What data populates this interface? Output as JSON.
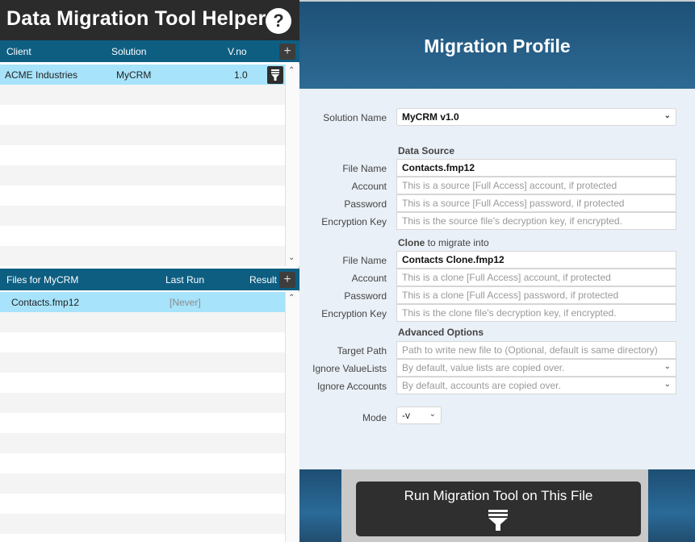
{
  "app": {
    "title": "Data Migration Tool Helper",
    "help_label": "?"
  },
  "clients_list": {
    "headers": {
      "client": "Client",
      "solution": "Solution",
      "version": "V.no"
    },
    "add_label": "+",
    "rows": [
      {
        "client": "ACME Industries",
        "solution": "MyCRM",
        "version": "1.0"
      }
    ]
  },
  "files_list": {
    "headers": {
      "files": "Files for MyCRM",
      "last_run": "Last Run",
      "result": "Result"
    },
    "add_label": "+",
    "rows": [
      {
        "file": "Contacts.fmp12",
        "last_run": "[Never]"
      }
    ]
  },
  "profile": {
    "title": "Migration Profile",
    "solution_name": {
      "label": "Solution Name",
      "value": "MyCRM v1.0"
    },
    "data_source": {
      "heading": "Data Source",
      "file_name": {
        "label": "File Name",
        "value": "Contacts.fmp12"
      },
      "account": {
        "label": "Account",
        "placeholder": "This is a source [Full Access] account, if protected"
      },
      "password": {
        "label": "Password",
        "placeholder": "This is a source [Full Access] password, if protected"
      },
      "encryption_key": {
        "label": "Encryption Key",
        "placeholder": "This is the source file's decryption key, if encrypted."
      }
    },
    "clone": {
      "heading_bold": "Clone",
      "heading_rest": " to migrate into",
      "file_name": {
        "label": "File Name",
        "value": "Contacts Clone.fmp12"
      },
      "account": {
        "label": "Account",
        "placeholder": "This is a clone [Full Access] account, if protected"
      },
      "password": {
        "label": "Password",
        "placeholder": "This is a clone [Full Access] password, if protected"
      },
      "encryption_key": {
        "label": "Encryption Key",
        "placeholder": "This is the clone file's decryption key, if encrypted."
      }
    },
    "advanced": {
      "heading": "Advanced Options",
      "target_path": {
        "label": "Target Path",
        "placeholder": "Path to write new file to (Optional, default is same directory)"
      },
      "ignore_valuelists": {
        "label": "Ignore ValueLists",
        "placeholder": "By default, value lists are copied over."
      },
      "ignore_accounts": {
        "label": "Ignore Accounts",
        "placeholder": "By default, accounts are copied over."
      }
    },
    "mode": {
      "label": "Mode",
      "value": "-v"
    },
    "run_button": "Run Migration Tool on This File"
  },
  "colors": {
    "header_dark": "#2b2b2b",
    "list_header": "#0e5e82",
    "selected_row": "#a7e3fb",
    "profile_bg": "#eaf0f7"
  }
}
